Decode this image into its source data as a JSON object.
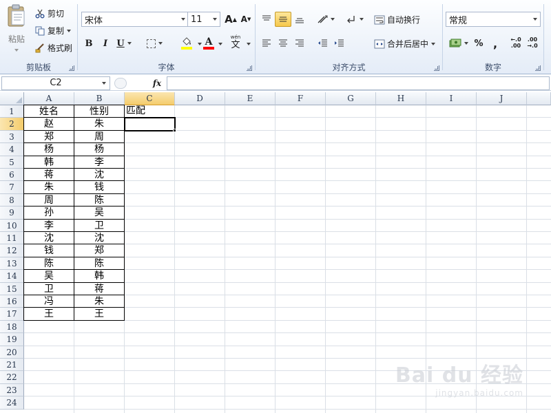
{
  "formula_bar": {
    "name_box": "C2",
    "fx": "fx",
    "value": ""
  },
  "ribbon": {
    "clipboard": {
      "paste_label": "粘贴",
      "cut_label": "剪切",
      "copy_label": "复制",
      "format_painter_label": "格式刷",
      "group_label": "剪贴板"
    },
    "font": {
      "font_name": "宋体",
      "font_size": "11",
      "bold": "B",
      "italic": "I",
      "underline": "U",
      "grow": "A",
      "shrink": "A",
      "font_color_letter": "A",
      "phonetic": "wén",
      "phonetic_char": "文",
      "group_label": "字体",
      "fill_color": "#ffff00",
      "text_color": "#ff0000"
    },
    "alignment": {
      "wrap_text_label": "自动换行",
      "merge_center_label": "合并后居中",
      "group_label": "对齐方式"
    },
    "number": {
      "format": "常规",
      "percent": "%",
      "comma": ",",
      "inc_decimal_top": "←.0",
      "inc_decimal_bottom": ".00",
      "dec_decimal_top": ".00",
      "dec_decimal_bottom": "→.0",
      "group_label": "数字"
    }
  },
  "columns": [
    "A",
    "B",
    "C",
    "D",
    "E",
    "F",
    "G",
    "H",
    "I",
    "J"
  ],
  "rows": [
    "1",
    "2",
    "3",
    "4",
    "5",
    "6",
    "7",
    "8",
    "9",
    "10",
    "11",
    "12",
    "13",
    "14",
    "15",
    "16",
    "17",
    "18",
    "19",
    "20",
    "21",
    "22",
    "23",
    "24"
  ],
  "table": {
    "header": {
      "A": "姓名",
      "B": "性别",
      "C": "匹配"
    },
    "rows": [
      {
        "A": "赵",
        "B": "朱"
      },
      {
        "A": "郑",
        "B": "周"
      },
      {
        "A": "杨",
        "B": "杨"
      },
      {
        "A": "韩",
        "B": "李"
      },
      {
        "A": "蒋",
        "B": "沈"
      },
      {
        "A": "朱",
        "B": "钱"
      },
      {
        "A": "周",
        "B": "陈"
      },
      {
        "A": "孙",
        "B": "吴"
      },
      {
        "A": "李",
        "B": "卫"
      },
      {
        "A": "沈",
        "B": "沈"
      },
      {
        "A": "钱",
        "B": "郑"
      },
      {
        "A": "陈",
        "B": "陈"
      },
      {
        "A": "吴",
        "B": "韩"
      },
      {
        "A": "卫",
        "B": "蒋"
      },
      {
        "A": "冯",
        "B": "朱"
      },
      {
        "A": "王",
        "B": "王"
      }
    ]
  },
  "watermark": {
    "main": "Bai du 经验",
    "sub": "jingyan.baidu.com"
  }
}
